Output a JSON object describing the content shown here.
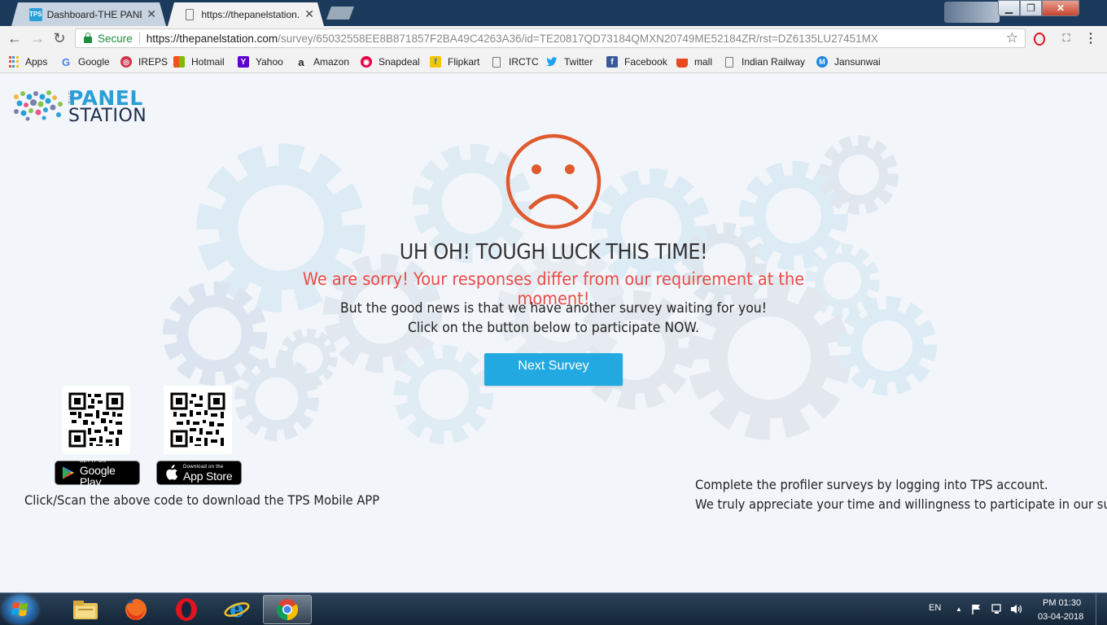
{
  "browser": {
    "tabs": [
      {
        "title": "Dashboard-THE PANEL S",
        "favicon": "TPS",
        "close": "✕",
        "active": false
      },
      {
        "title": "https://thepanelstation.c",
        "favicon": "",
        "close": "✕",
        "active": true
      }
    ],
    "window_controls": {
      "minimize": "▁",
      "maximize": "❐",
      "close": "✕"
    },
    "nav": {
      "back": "←",
      "forward": "→",
      "reload": "↻"
    },
    "address": {
      "secure_label": "Secure",
      "url_host": "https://thepanelstation.com",
      "url_path": "/survey/65032558EE8B871857F2BA49C4263A36/id=TE20817QD73184QMXN20749ME52184ZR/rst=DZ6135LU27451MX"
    },
    "star": "☆",
    "ext_opera": "O",
    "ext_pdf": "⛶",
    "menu": "⋮",
    "bookmarks": [
      {
        "label": "Apps",
        "icon": "apps-grid-icon",
        "color": ""
      },
      {
        "label": "Google",
        "icon": "google-icon",
        "color": "#4285f4",
        "glyph": "G"
      },
      {
        "label": "IREPS",
        "icon": "ireps-icon",
        "color": "#d0344a",
        "glyph": "◎"
      },
      {
        "label": "Hotmail",
        "icon": "windows-icon",
        "color": "#f25022",
        "glyph": "▦"
      },
      {
        "label": "Yahoo",
        "icon": "yahoo-icon",
        "color": "#5f01d1",
        "glyph": "Y"
      },
      {
        "label": "Amazon",
        "icon": "amazon-icon",
        "color": "#222222",
        "glyph": "a"
      },
      {
        "label": "Snapdeal",
        "icon": "snapdeal-icon",
        "color": "#e40046",
        "glyph": "◉"
      },
      {
        "label": "Flipkart",
        "icon": "flipkart-icon",
        "color": "#2874f0",
        "glyph": "f"
      },
      {
        "label": "IRCTC",
        "icon": "page-icon",
        "color": "",
        "glyph": ""
      },
      {
        "label": "Twitter",
        "icon": "twitter-icon",
        "color": "#1da1f2",
        "glyph": "🐦"
      },
      {
        "label": "Facebook",
        "icon": "facebook-icon",
        "color": "#3b5998",
        "glyph": "f"
      },
      {
        "label": "mall",
        "icon": "mall-basket-icon",
        "color": "#e8491d",
        "glyph": "⛍"
      },
      {
        "label": "Indian Railway",
        "icon": "page-icon",
        "color": "",
        "glyph": ""
      },
      {
        "label": "Jansunwai",
        "icon": "jansunwai-icon",
        "color": "#1e88e5",
        "glyph": "M"
      }
    ]
  },
  "page": {
    "logo": {
      "the": "THE",
      "panel": "PANEL",
      "station": "STATION"
    },
    "heading": "UH OH! TOUGH LUCK THIS TIME!",
    "sorry": "We are sorry! Your responses differ from our requirement at the moment!",
    "good_news_line1": "But the good news is that we have another survey waiting for you!",
    "good_news_line2": "Click on the button below to participate NOW.",
    "next_button": "Next Survey",
    "google_play": {
      "small": "GET IT ON",
      "big": "Google Play"
    },
    "app_store": {
      "small": "Download on the",
      "big": "App Store"
    },
    "qr_caption": "Click/Scan the above code to download the TPS Mobile APP",
    "profiler_line1": "Complete the profiler surveys by logging into TPS account.",
    "profiler_line2": "We truly appreciate your time and willingness to participate in our surveys!",
    "colors": {
      "accent": "#23a9e1",
      "sad_face": "#e05a2f",
      "sorry_text": "#e94b47"
    }
  },
  "taskbar": {
    "apps": [
      "explorer-icon",
      "firefox-icon",
      "opera-icon",
      "ie-icon",
      "chrome-icon"
    ],
    "language": "EN",
    "tray_up": "▲",
    "time": "PM 01:30",
    "date": "03-04-2018"
  }
}
